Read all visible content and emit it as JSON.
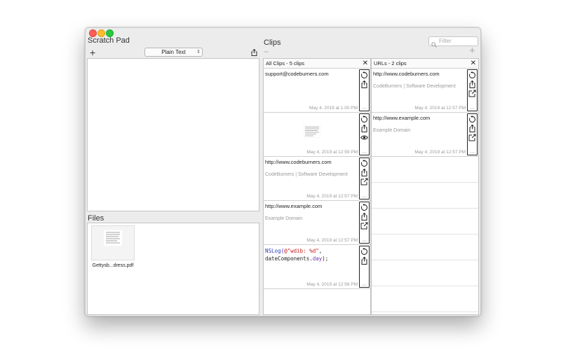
{
  "scratch_pad": {
    "title": "Scratch Pad",
    "add_label": "+",
    "format": "Plain Text",
    "files_title": "Files",
    "files": [
      {
        "name": "Gettysb...dress.pdf"
      }
    ]
  },
  "clips": {
    "title": "Clips",
    "filter_placeholder": "Filter",
    "minus_label": "−",
    "plus_label": "+",
    "columns": [
      {
        "header": "All Clips - 5 clips",
        "close": "✕",
        "items": [
          {
            "title": "support@codeburners.com",
            "subtitle": "",
            "date": "May 4, 2019 at 1:00 PM",
            "tools": [
              "restore-icon",
              "share-icon"
            ]
          },
          {
            "title": "",
            "subtitle": "",
            "date": "May 4, 2019 at 12:59 PM",
            "tools": [
              "restore-icon",
              "share-icon",
              "eye-icon"
            ],
            "image": true
          },
          {
            "title": "http://www.codeburners.com",
            "subtitle": "CodeBurners | Software Development",
            "date": "May 4, 2019 at 12:57 PM",
            "tools": [
              "restore-icon",
              "share-icon",
              "open-external-icon"
            ]
          },
          {
            "title": "http://www.example.com",
            "subtitle": "Example Domain",
            "date": "May 4, 2019 at 12:57 PM",
            "tools": [
              "restore-icon",
              "share-icon",
              "open-external-icon"
            ]
          },
          {
            "title": "",
            "subtitle": "",
            "date": "May 4, 2019 at 12:56 PM",
            "tools": [
              "restore-icon",
              "share-icon"
            ],
            "code": {
              "line1_fn": "NSLog(",
              "line1_str": "@\"wdib: %d\"",
              "line1_end": ",",
              "line2_pre": "dateComponents.",
              "line2_prop": "day",
              "line2_end": ");"
            }
          }
        ]
      },
      {
        "header": "URLs - 2 clips",
        "close": "✕",
        "items": [
          {
            "title": "http://www.codeburners.com",
            "subtitle": "CodeBurners | Software Development",
            "date": "May 4, 2019 at 12:57 PM",
            "tools": [
              "restore-icon",
              "share-icon",
              "open-external-icon"
            ]
          },
          {
            "title": "http://www.example.com",
            "subtitle": "Example Domain",
            "date": "May 4, 2019 at 12:57 PM",
            "tools": [
              "restore-icon",
              "share-icon",
              "open-external-icon"
            ]
          }
        ]
      }
    ],
    "more_label": "···"
  }
}
